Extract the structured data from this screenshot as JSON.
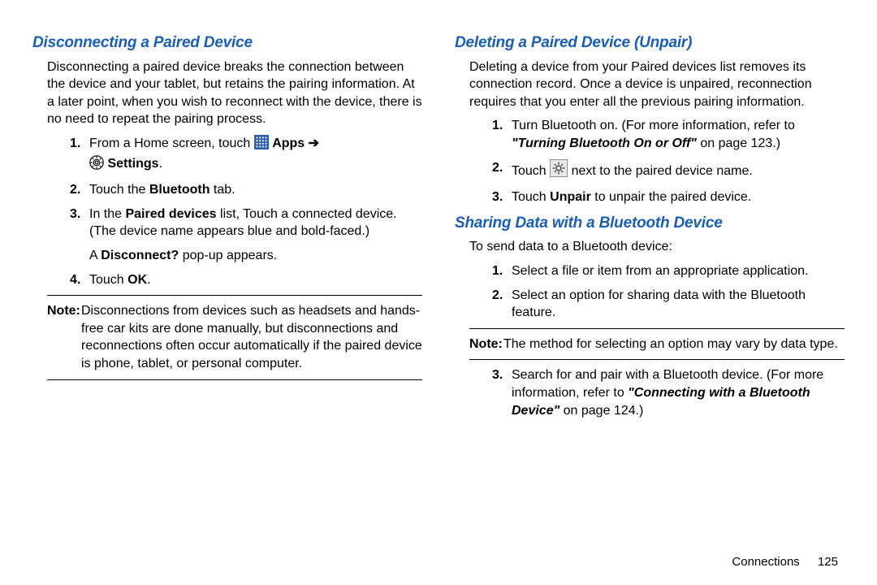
{
  "left": {
    "heading": "Disconnecting a Paired Device",
    "intro": "Disconnecting a paired device breaks the connection between the device and your tablet, but retains the pairing information. At a later point, when you wish to reconnect with the device, there is no need to repeat the pairing process.",
    "step1a": "From a Home screen, touch ",
    "apps": " Apps ",
    "arrow": "➔",
    "settings": " Settings",
    "step2a": "Touch the ",
    "step2b": "Bluetooth",
    "step2c": " tab.",
    "step3a": "In the ",
    "step3b": "Paired devices",
    "step3c": " list, Touch a connected device. (The device name appears blue and bold-faced.)",
    "step3d": "A ",
    "step3e": "Disconnect?",
    "step3f": " pop-up appears.",
    "step4a": "Touch ",
    "step4b": "OK",
    "step4c": ".",
    "noteLabel": "Note:",
    "noteBody": "Disconnections from devices such as headsets and hands-free car kits are done manually, but disconnections and reconnections often occur automatically if the paired device is phone, tablet, or personal computer."
  },
  "right": {
    "heading1": "Deleting a Paired Device (Unpair)",
    "intro1": "Deleting a device from your Paired devices list removes its connection record. Once a device is unpaired, reconnection requires that you enter all the previous pairing information.",
    "r1a": "Turn Bluetooth on. (For more information, refer to ",
    "r1b": "\"Turning Bluetooth On or Off\"",
    "r1c": " on page 123.)",
    "r2a": "Touch ",
    "r2b": " next to the paired device name.",
    "r3a": "Touch ",
    "r3b": "Unpair",
    "r3c": " to unpair the paired device.",
    "heading2": "Sharing Data with a Bluetooth Device",
    "intro2": "To send data to a Bluetooth device:",
    "s1": "Select a file or item from an appropriate application.",
    "s2": "Select an option for sharing data with the Bluetooth feature.",
    "noteLabel": "Note:",
    "noteBody": "The method for selecting an option may vary by data type.",
    "s3a": "Search for and pair with a Bluetooth device. (For more information, refer to ",
    "s3b": "\"Connecting with a Bluetooth Device\"",
    "s3c": " on page 124.)"
  },
  "footer": {
    "section": "Connections",
    "page": "125"
  }
}
